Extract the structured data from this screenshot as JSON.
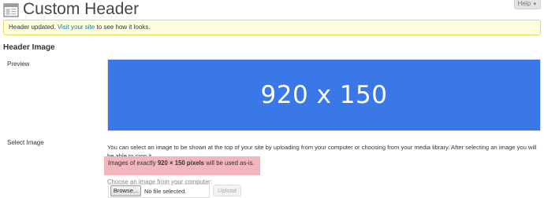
{
  "header": {
    "title": "Custom Header",
    "help_label": "Help",
    "help_icon": "chevron-down-icon"
  },
  "notice": {
    "text_before": "Header updated. ",
    "link_text": "Visit your site",
    "text_after": " to see how it looks."
  },
  "section": {
    "heading": "Header Image"
  },
  "preview": {
    "label": "Preview",
    "image_text": "920 x 150",
    "image_color": "#3b78e7"
  },
  "select_image": {
    "label": "Select Image",
    "description": "You can select an image to be shown at the top of your site by uploading from your computer or choosing from your media library. After selecting an image you will be able to crop it.",
    "size_note_before": "Images of exactly ",
    "size_note_bold": "920 × 150 pixels",
    "size_note_after": " will be used as-is.",
    "highlight_color": "#f2b6bf",
    "choose_label": "Choose an image from your computer:",
    "browse_label": "Browse...",
    "file_status": "No file selected.",
    "upload_label": "Upload"
  },
  "colors": {
    "notice_bg": "#ffffe0",
    "notice_border": "#e6db55",
    "link": "#21759b"
  }
}
